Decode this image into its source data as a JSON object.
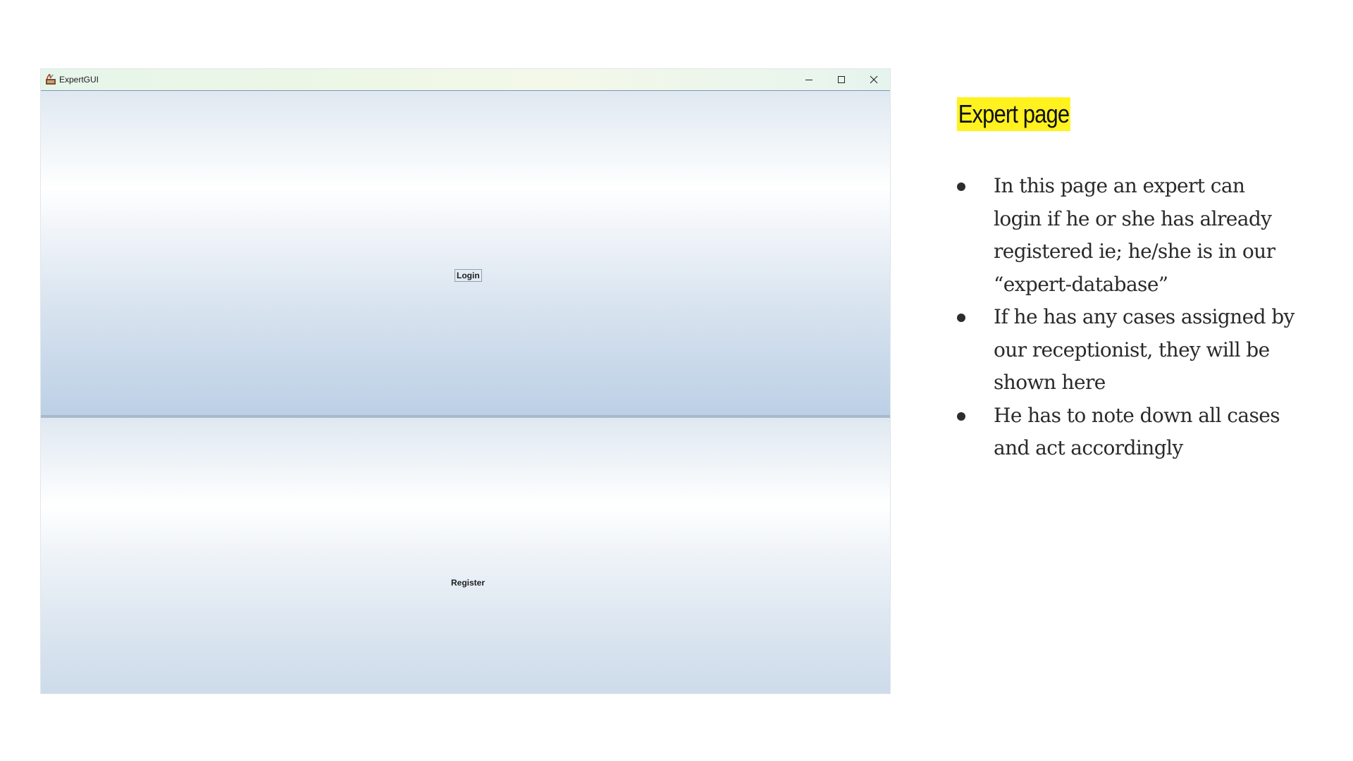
{
  "window": {
    "title": "ExpertGUI",
    "icons": {
      "app": "java-app-icon",
      "minimize": "minimize-icon",
      "maximize": "maximize-icon",
      "close": "close-icon"
    }
  },
  "buttons": {
    "login_label": "Login",
    "register_label": "Register"
  },
  "slide": {
    "heading": "Expert page",
    "heading_highlight_color": "#fff21f",
    "bullets": [
      "In this page an expert can login if he or she has already registered ie; he/she is in our “expert-database”",
      "If he has any cases assigned by our receptionist, they will be shown here",
      "He has to note down all cases and act accordingly"
    ]
  }
}
